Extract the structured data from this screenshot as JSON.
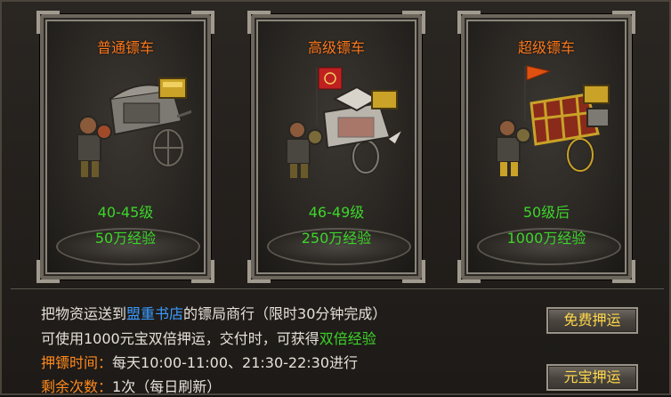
{
  "carts": [
    {
      "title": "普通镖车",
      "level": "40-45级",
      "exp": "50万经验"
    },
    {
      "title": "高级镖车",
      "level": "46-49级",
      "exp": "250万经验"
    },
    {
      "title": "超级镖车",
      "level": "50级后",
      "exp": "1000万经验"
    }
  ],
  "info": {
    "line1_pre": "把物资运送到",
    "line1_place": "盟重书店",
    "line1_post": "的镖局商行（限时30分钟完成）",
    "line2_pre": "可使用1000元宝双倍押运，交付时，可获得",
    "line2_hl": "双倍经验",
    "time_label": "押镖时间：",
    "time_value": "每天10:00-11:00、21:30-22:30进行",
    "count_label": "剩余次数：",
    "count_value": "1次（每日刷新）"
  },
  "buttons": {
    "free": "免费押运",
    "yuanbao": "元宝押运"
  },
  "colors": {
    "title_orange": "#ff7a1e",
    "green": "#3dd42a",
    "blue": "#3a9cff",
    "button_text": "#ffd84a"
  }
}
